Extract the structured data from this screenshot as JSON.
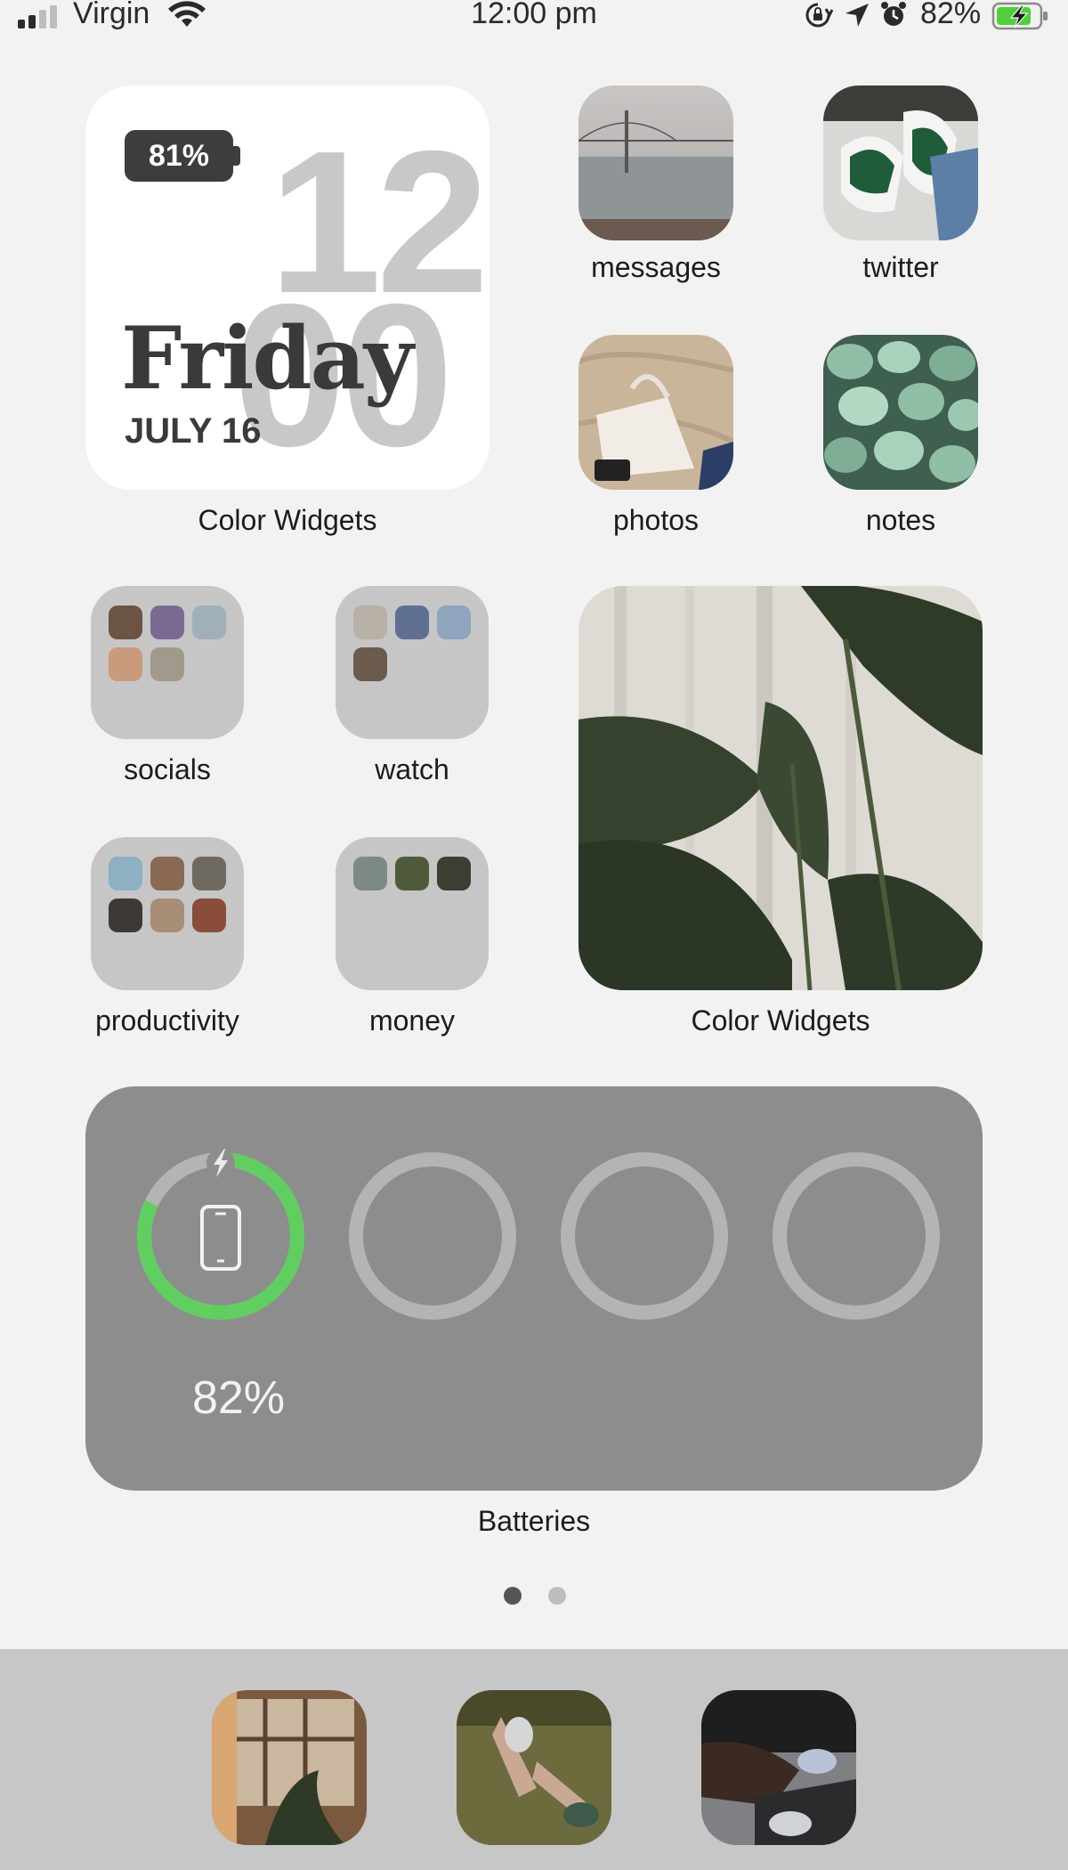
{
  "status_bar": {
    "carrier": "Virgin",
    "time": "12:00 pm",
    "battery_percent": "82%",
    "icons": [
      "signal-icon",
      "wifi-icon",
      "orientation-lock-icon",
      "location-icon",
      "alarm-icon",
      "battery-charging-icon"
    ]
  },
  "clock_widget": {
    "battery_label": "81%",
    "hour": "12",
    "minute": "00",
    "day": "Friday",
    "date": "JULY 16",
    "label": "Color Widgets"
  },
  "apps": {
    "messages": "messages",
    "twitter": "twitter",
    "photos": "photos",
    "notes": "notes"
  },
  "folders": {
    "socials": "socials",
    "watch": "watch",
    "productivity": "productivity",
    "money": "money"
  },
  "photo_widget": {
    "label": "Color Widgets"
  },
  "batteries_widget": {
    "label": "Batteries",
    "device_percent": "82%",
    "device_level": 0.82,
    "charging": true,
    "colors": {
      "ring_active": "#5fcf5f",
      "ring_empty": "#b4b4b4",
      "background": "#8d8d8d"
    }
  },
  "page_indicator": {
    "pages": 2,
    "current": 1
  },
  "dock": {
    "apps": [
      "dock-app-1",
      "dock-app-2",
      "dock-app-3"
    ]
  }
}
